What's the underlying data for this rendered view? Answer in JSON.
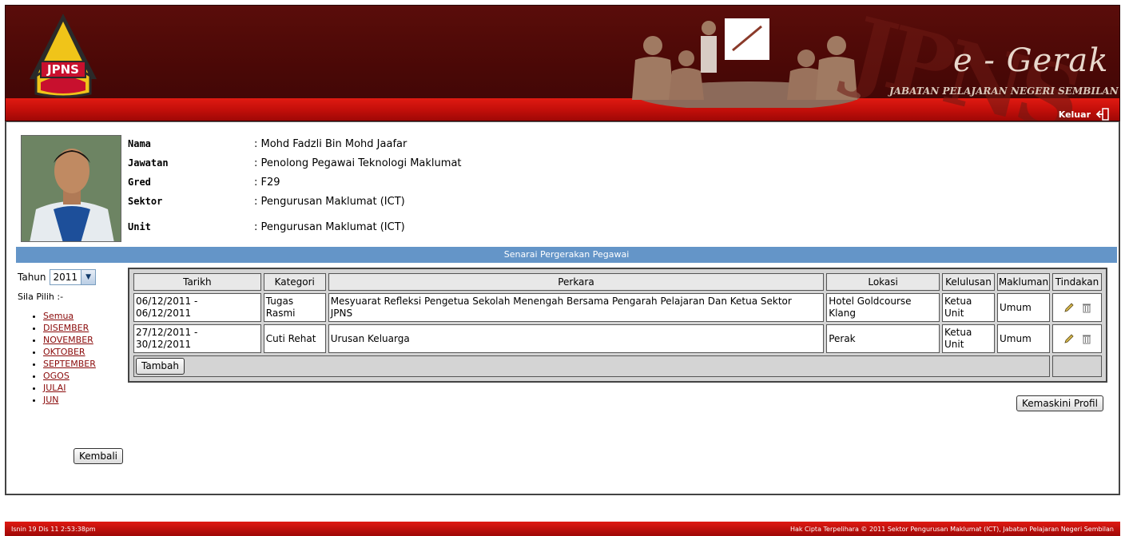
{
  "header": {
    "logo_text": "JPNS",
    "brand_title": "e - Gerak",
    "brand_subtitle": "JABATAN PELAJARAN NEGERI SEMBILAN",
    "watermark_letters": "JPNS",
    "logout_label": "Keluar",
    "colors": {
      "header_bg": "#4a0806",
      "red_bar": "#c40f0a"
    }
  },
  "profile": {
    "fields": [
      {
        "label": "Nama",
        "value": ": Mohd Fadzli Bin Mohd Jaafar"
      },
      {
        "label": "Jawatan",
        "value": ": Penolong Pegawai Teknologi Maklumat"
      },
      {
        "label": "Gred",
        "value": ": F29"
      },
      {
        "label": "Sektor",
        "value": ": Pengurusan Maklumat (ICT)"
      },
      {
        "label": "Unit",
        "value": ": Pengurusan Maklumat (ICT)"
      }
    ]
  },
  "section_title": "Senarai Pergerakan Pegawai",
  "filter": {
    "year_label": "Tahun",
    "year_value": "2011",
    "pick_label": "Sila Pilih :-",
    "months": [
      "Semua",
      "DISEMBER",
      "NOVEMBER",
      "OKTOBER",
      "SEPTEMBER",
      "OGOS",
      "JULAI",
      "JUN"
    ],
    "back_label": "Kembali"
  },
  "table": {
    "headers": [
      "Tarikh",
      "Kategori",
      "Perkara",
      "Lokasi",
      "Kelulusan",
      "Makluman",
      "Tindakan"
    ],
    "rows": [
      {
        "tarikh_from": "06/12/2011 -",
        "tarikh_to": "06/12/2011",
        "kategori_1": "Tugas",
        "kategori_2": "Rasmi",
        "perkara_1": "Mesyuarat Refleksi Pengetua Sekolah Menengah Bersama Pengarah Pelajaran Dan Ketua Sektor",
        "perkara_2": "JPNS",
        "lokasi_1": "Hotel Goldcourse",
        "lokasi_2": "Klang",
        "kelulusan_1": "Ketua",
        "kelulusan_2": "Unit",
        "makluman": "Umum"
      },
      {
        "tarikh_from": "27/12/2011 -",
        "tarikh_to": "30/12/2011",
        "kategori_1": "Cuti Rehat",
        "kategori_2": "",
        "perkara_1": "Urusan Keluarga",
        "perkara_2": "",
        "lokasi_1": "Perak",
        "lokasi_2": "",
        "kelulusan_1": "Ketua",
        "kelulusan_2": "Unit",
        "makluman": "Umum"
      }
    ],
    "add_label": "Tambah",
    "action_icons": [
      "edit-icon",
      "delete-icon"
    ]
  },
  "update_profile_label": "Kemaskini Profil",
  "footer": {
    "datetime": "Isnin 19 Dis 11   2:53:38pm",
    "copyright": "Hak Cipta Terpelihara © 2011 Sektor Pengurusan Maklumat (ICT), Jabatan Pelajaran Negeri Sembilan"
  }
}
